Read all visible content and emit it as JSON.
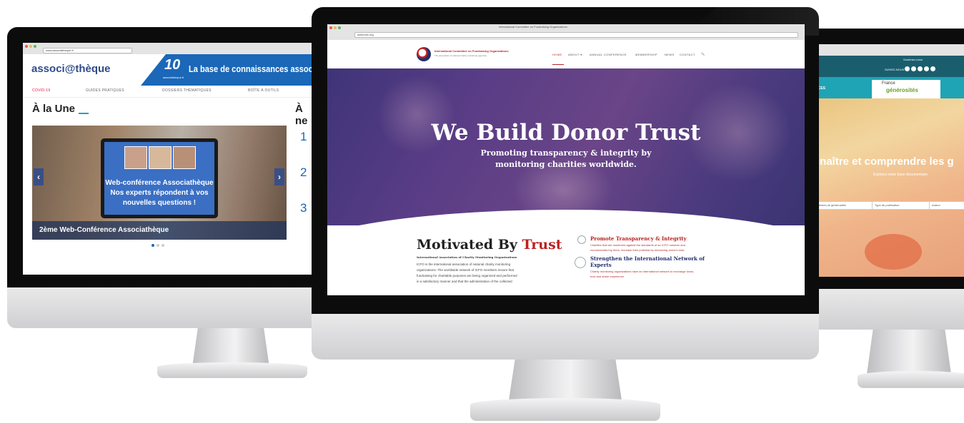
{
  "left_site": {
    "url": "www.associatheque.fr",
    "logo": "associ@thèque",
    "badge_number": "10",
    "badge_sub": "associatheque.fr",
    "header_title": "La base de connaissances associative",
    "nav": [
      "COVID-19",
      "GUIDES PRATIQUES",
      "DOSSIERS THÉMATIQUES",
      "BOÎTE À OUTILS"
    ],
    "section_title": "À la Une",
    "side_title": "À ne",
    "side_numbers": [
      "1",
      "2",
      "3"
    ],
    "slide_text_1": "Web-conférence Associathèque",
    "slide_text_2": "Nos experts répondent à vos",
    "slide_text_3": "nouvelles questions !",
    "slide_caption": "2ème Web-Conférence Associathèque",
    "prev": "‹",
    "next": "›"
  },
  "center_site": {
    "window_title": "International Committee on Fundraising Organizations",
    "url": "www.icfo.org",
    "logo_name": "International Committee on Fundraising Organizations",
    "logo_sub": "The association of national charity monitoring agencies",
    "nav": [
      "HOME",
      "ABOUT ▾",
      "ANNUAL CONFERENCE",
      "MEMBERSHIP",
      "NEWS",
      "CONTACT",
      "🔍"
    ],
    "hero_title": "We Build Donor Trust",
    "hero_line1": "Promoting transparency & integrity by",
    "hero_line2": "monitoring charities worldwide.",
    "motivated_a": "Motivated By ",
    "motivated_b": "Trust",
    "motivated_sub": "International Association of Charity Monitoring Organizations",
    "body_lines": [
      "ICFO is the international association of national charity monitoring",
      "organizations. The worldwide network of ICFO members ensure that",
      "fundraising for charitable purposes are being organized and performed",
      "in a satisfactory manner and that the administration of the collected"
    ],
    "feature1_title": "Promote Transparency & Integrity",
    "feature1_text1": "Charities that are monitored against the standards of an ICFO member and",
    "feature1_text2": "recommended by them, increase their potential by enhancing donor's trust.",
    "feature2_title1": "Strengthen the International Network of",
    "feature2_title2": "Experts",
    "feature2_text1": "Charity monitoring organizations have an international network to exchange know-",
    "feature2_text2": "how and share experience."
  },
  "right_site": {
    "top_text": "Soutenez-nous",
    "follow_text": "SUIVEZ-NOUS",
    "nav_item": "RESSOURCES",
    "partner_logo_1": "France",
    "partner_logo_2": "générosités",
    "hero_title": "nnaître et comprendre les g",
    "hero_sub": "Explorez notre base documentaire",
    "select_1": "Thèmes de générosités",
    "select_2": "Type de publication",
    "select_3": "Auteur",
    "brand_red": "#c23a3a",
    "accent_teal": "#1fa4b5"
  }
}
